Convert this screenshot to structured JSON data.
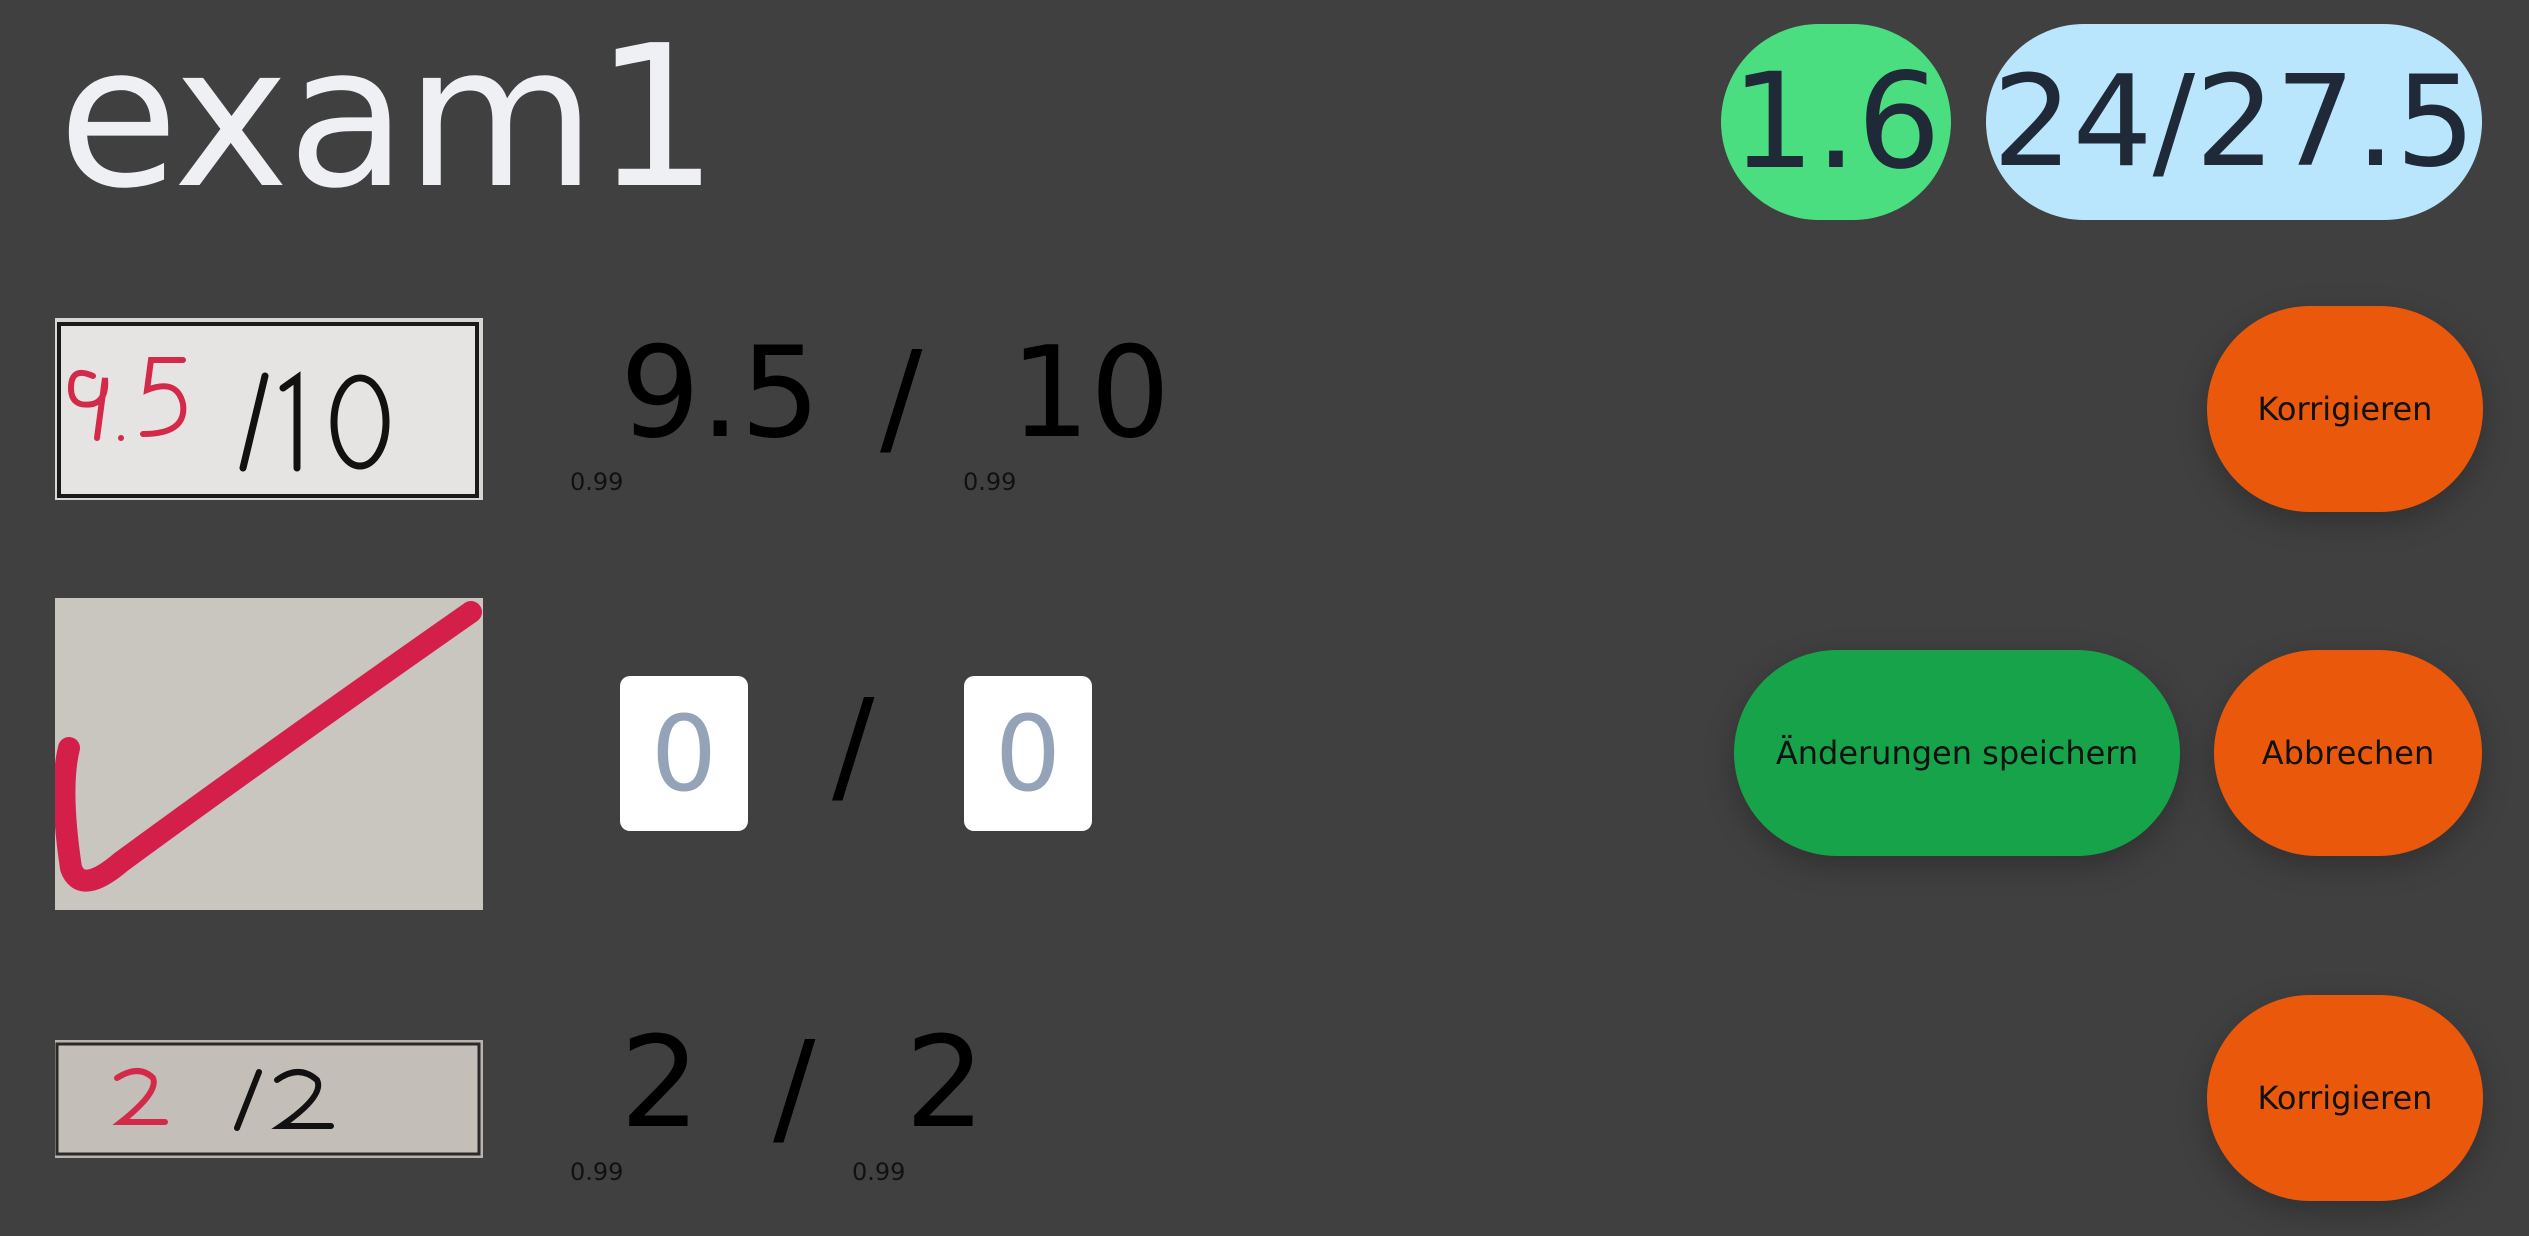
{
  "exam": {
    "title": "exam1",
    "grade": "1.6",
    "total_score": "24/27.5"
  },
  "colors": {
    "background": "#404040",
    "grade_pill": "#4ade80",
    "score_pill": "#bae6fd",
    "action_orange": "#ea580c",
    "save_green": "#16a34a"
  },
  "rows": [
    {
      "thumbnail": "handwritten-score-9.5-of-10",
      "points": "9.5",
      "points_confidence": "0.99",
      "separator": "/",
      "max_points": "10",
      "max_points_confidence": "0.99",
      "action_label": "Korrigieren"
    },
    {
      "thumbnail": "handwritten-checkmark",
      "points_placeholder": "0",
      "separator": "/",
      "max_points_placeholder": "0",
      "save_label": "Änderungen speichern",
      "cancel_label": "Abbrechen"
    },
    {
      "thumbnail": "handwritten-score-2-of-2",
      "points": "2",
      "points_confidence": "0.99",
      "separator": "/",
      "max_points": "2",
      "max_points_confidence": "0.99",
      "action_label": "Korrigieren"
    }
  ]
}
